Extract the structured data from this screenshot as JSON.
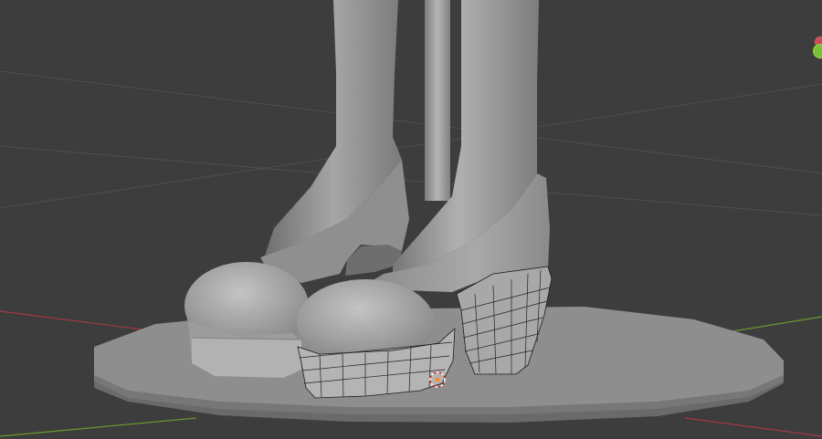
{
  "app": "3D viewport",
  "viewport": {
    "background_color": "#3d3d3d",
    "grid_line_color": "#4f4f4f",
    "x_axis_color": "#a33a43",
    "y_axis_color": "#6a9a2c",
    "object_mode": "edit",
    "selection_highlight": "#ff8a1f"
  },
  "scene": {
    "objects": [
      "base-platform",
      "left-shoe",
      "right-shoe",
      "left-leg",
      "right-leg",
      "support-pole"
    ],
    "edited_object": "right-shoe-heel-and-sole",
    "origin_marker": "3d-cursor"
  },
  "gizmo": {
    "icons": [
      "y-axis-dot-icon",
      "x-axis-dot-icon"
    ]
  }
}
